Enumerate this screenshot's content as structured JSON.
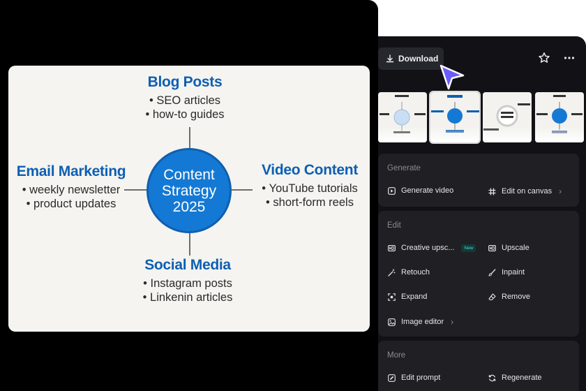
{
  "mindmap": {
    "center": [
      "Content",
      "Strategy",
      "2025"
    ],
    "top": {
      "title": "Blog Posts",
      "items": [
        "SEO articles",
        "how-to guides"
      ]
    },
    "left": {
      "title": "Email Marketing",
      "items": [
        "weekly newsletter",
        "product updates"
      ]
    },
    "right": {
      "title": "Video Content",
      "items": [
        "YouTube tutorials",
        "short-form reels"
      ]
    },
    "bottom": {
      "title": "Social Media",
      "items": [
        "Instagram posts",
        "Linkenin articles"
      ]
    }
  },
  "toolbar": {
    "download_label": "Download"
  },
  "icons": {
    "download": "download-icon",
    "star": "star-icon",
    "more": "more-horizontal-icon",
    "cursor": "pointer-cursor-icon"
  },
  "colors": {
    "accent": "#1479d4",
    "cursor": "#6a5cff",
    "panel": "#1f1f24",
    "badge": "#5fd3c3"
  },
  "generate": {
    "title": "Generate",
    "actions": [
      {
        "label": "Generate video",
        "icon": "play-square-icon"
      },
      {
        "label": "Edit on canvas",
        "icon": "grid-hash-icon"
      }
    ]
  },
  "edit": {
    "title": "Edit",
    "actions": [
      {
        "label": "Creative upsc...",
        "badge": "New",
        "icon": "hd-icon"
      },
      {
        "label": "Upscale",
        "icon": "hd-icon"
      },
      {
        "label": "Retouch",
        "icon": "magic-wand-icon"
      },
      {
        "label": "Inpaint",
        "icon": "brush-icon"
      },
      {
        "label": "Expand",
        "icon": "expand-icon"
      },
      {
        "label": "Remove",
        "icon": "eraser-icon"
      },
      {
        "label": "Image editor",
        "icon": "image-icon"
      }
    ]
  },
  "more": {
    "title": "More",
    "actions": [
      {
        "label": "Edit prompt",
        "icon": "edit-icon"
      },
      {
        "label": "Regenerate",
        "icon": "refresh-icon"
      }
    ]
  }
}
